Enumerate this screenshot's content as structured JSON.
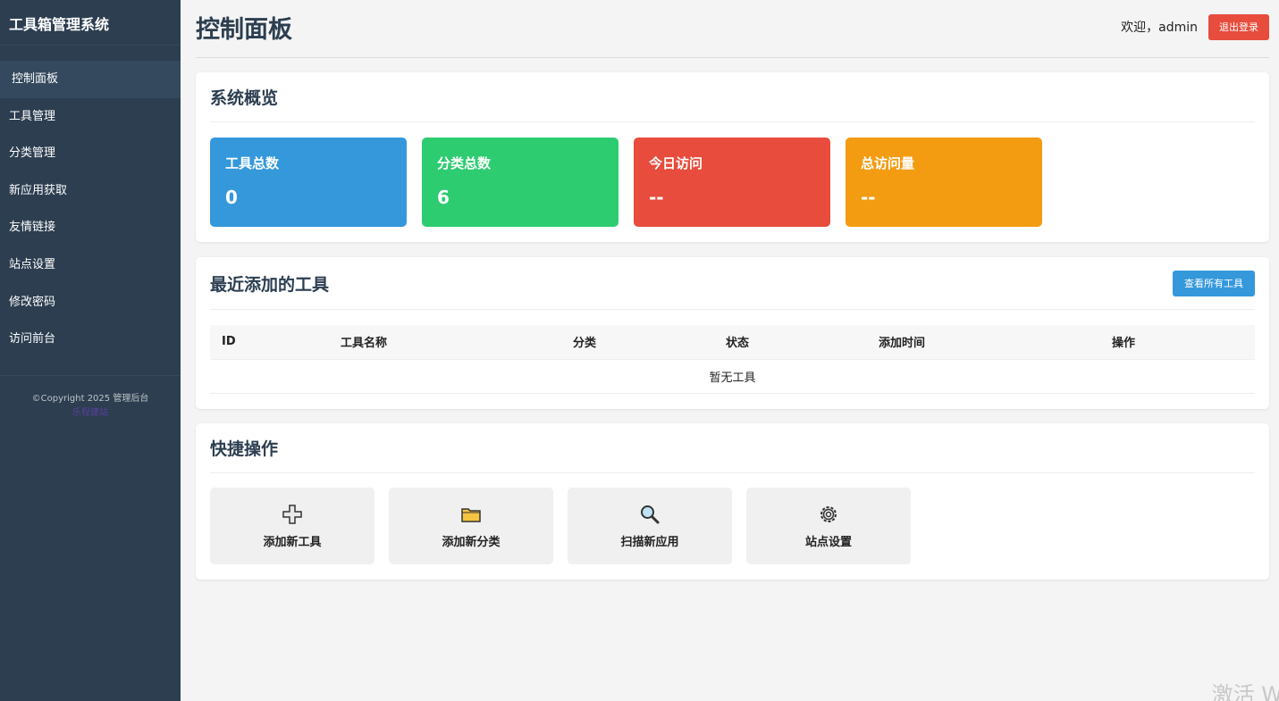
{
  "sidebar": {
    "brand": "工具箱管理系统",
    "items": [
      {
        "label": "控制面板",
        "active": true
      },
      {
        "label": "工具管理"
      },
      {
        "label": "分类管理"
      },
      {
        "label": "新应用获取"
      },
      {
        "label": "友情链接"
      },
      {
        "label": "站点设置"
      },
      {
        "label": "修改密码"
      },
      {
        "label": "访问前台"
      }
    ],
    "copyright": "©Copyright 2025 管理后台",
    "copyright_link": "乐程建站"
  },
  "header": {
    "title": "控制面板",
    "welcome": "欢迎，admin",
    "logout_label": "退出登录"
  },
  "overview": {
    "title": "系统概览",
    "stats": [
      {
        "label": "工具总数",
        "value": "0",
        "color": "#3498db"
      },
      {
        "label": "分类总数",
        "value": "6",
        "color": "#2ecc71"
      },
      {
        "label": "今日访问",
        "value": "--",
        "color": "#e74c3c"
      },
      {
        "label": "总访问量",
        "value": "--",
        "color": "#f39c12"
      }
    ]
  },
  "recent": {
    "title": "最近添加的工具",
    "view_all_label": "查看所有工具",
    "columns": [
      "ID",
      "工具名称",
      "分类",
      "状态",
      "添加时间",
      "操作"
    ],
    "empty_text": "暂无工具"
  },
  "quick": {
    "title": "快捷操作",
    "actions": [
      {
        "label": "添加新工具",
        "icon": "plus-icon"
      },
      {
        "label": "添加新分类",
        "icon": "folder-icon"
      },
      {
        "label": "扫描新应用",
        "icon": "search-icon"
      },
      {
        "label": "站点设置",
        "icon": "gear-icon"
      }
    ]
  },
  "watermark": "激活 W"
}
